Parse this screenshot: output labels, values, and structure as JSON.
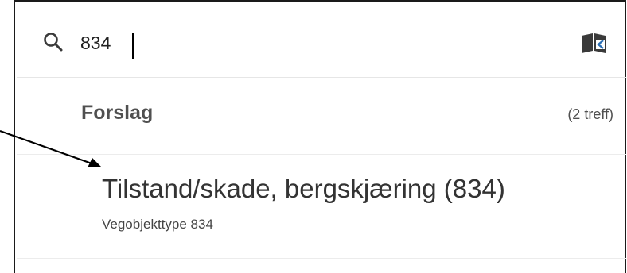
{
  "search": {
    "value": "834",
    "icon": "search-icon",
    "book_icon": "map-book-icon"
  },
  "suggestions": {
    "title": "Forslag",
    "count": "(2 treff)",
    "items": [
      {
        "title": "Tilstand/skade, bergskjæring (834)",
        "subtitle": "Vegobjekttype 834"
      }
    ]
  },
  "colors": {
    "frame": "#1a1a1a",
    "text_primary": "#333333",
    "text_secondary": "#505050",
    "divider": "#e6e6e6"
  }
}
